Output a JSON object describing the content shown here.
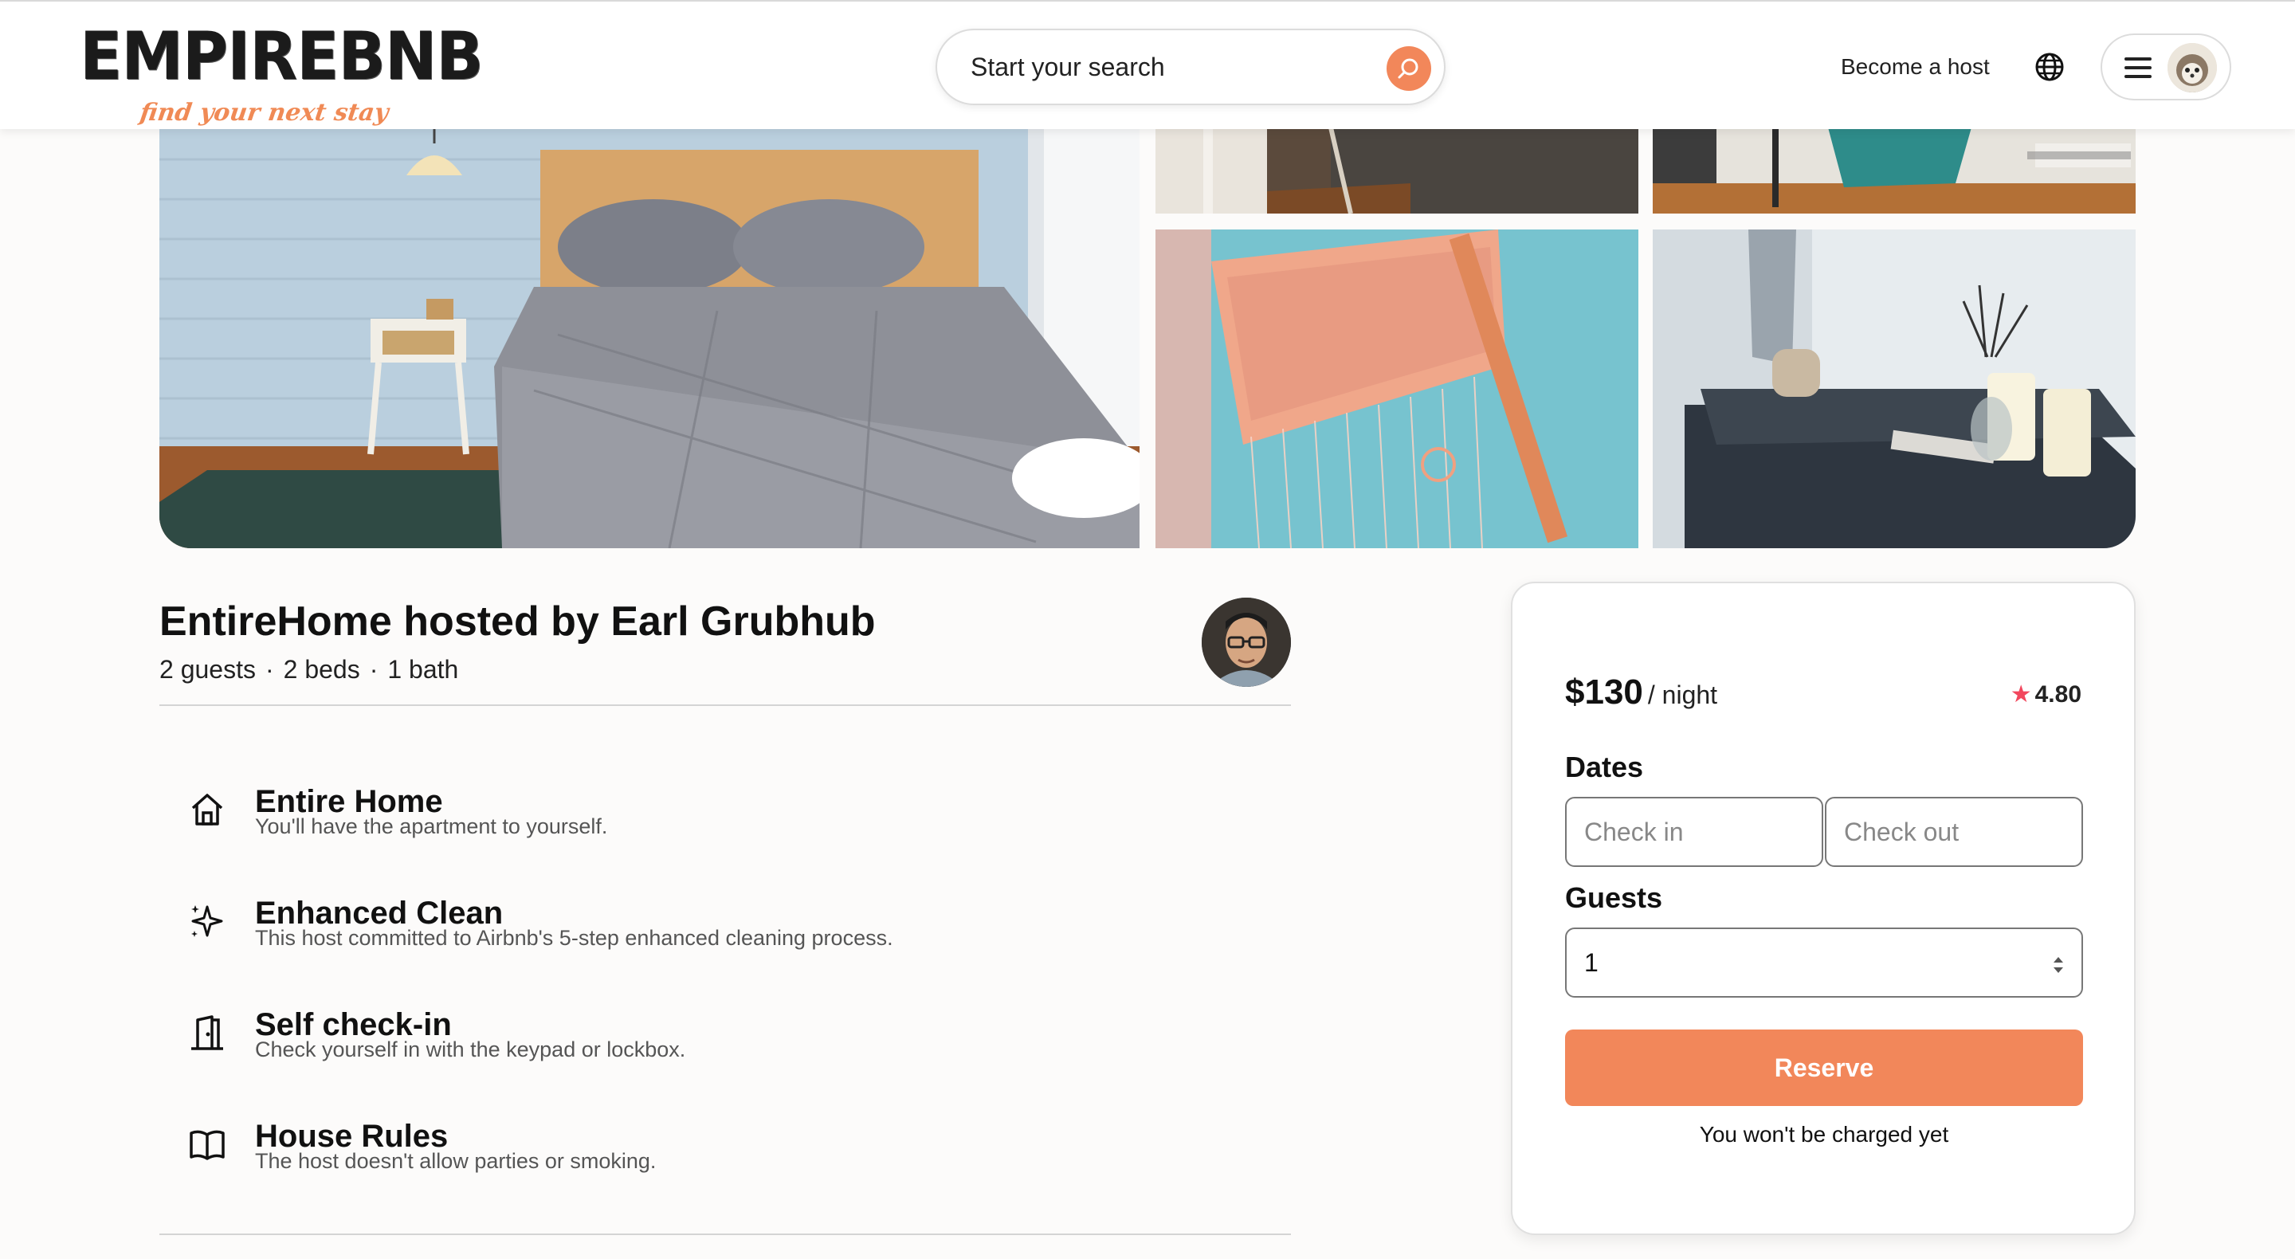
{
  "header": {
    "logo_text": "EMPIREBNB",
    "logo_tagline": "find your next stay",
    "search_placeholder": "Start your search",
    "become_host_label": "Become a host",
    "icons": [
      "search-icon",
      "globe-icon",
      "menu-icon",
      "user-avatar"
    ]
  },
  "listing": {
    "title": "EntireHome hosted by Earl Grubhub",
    "guests": "2 guests",
    "beds": "2 beds",
    "baths": "1 bath",
    "separator": "·",
    "features": [
      {
        "icon": "home-icon",
        "name": "Entire Home",
        "description": "You'll have the apartment to yourself."
      },
      {
        "icon": "sparkle-icon",
        "name": "Enhanced Clean",
        "description": "This host committed to Airbnb's 5-step enhanced cleaning process."
      },
      {
        "icon": "door-icon",
        "name": "Self check-in",
        "description": "Check yourself in with the keypad or lockbox."
      },
      {
        "icon": "book-icon",
        "name": "House Rules",
        "description": "The host doesn't allow parties or smoking."
      }
    ]
  },
  "booking": {
    "price": "$130",
    "per_night": "/ night",
    "rating": "4.80",
    "dates_label": "Dates",
    "check_in_placeholder": "Check in",
    "check_out_placeholder": "Check out",
    "guests_label": "Guests",
    "guests_value": "1",
    "reserve_label": "Reserve",
    "note": "You won't be charged yet"
  },
  "colors": {
    "accent": "#f2875a",
    "star": "#f2475d",
    "background": "#fcfbfa"
  }
}
